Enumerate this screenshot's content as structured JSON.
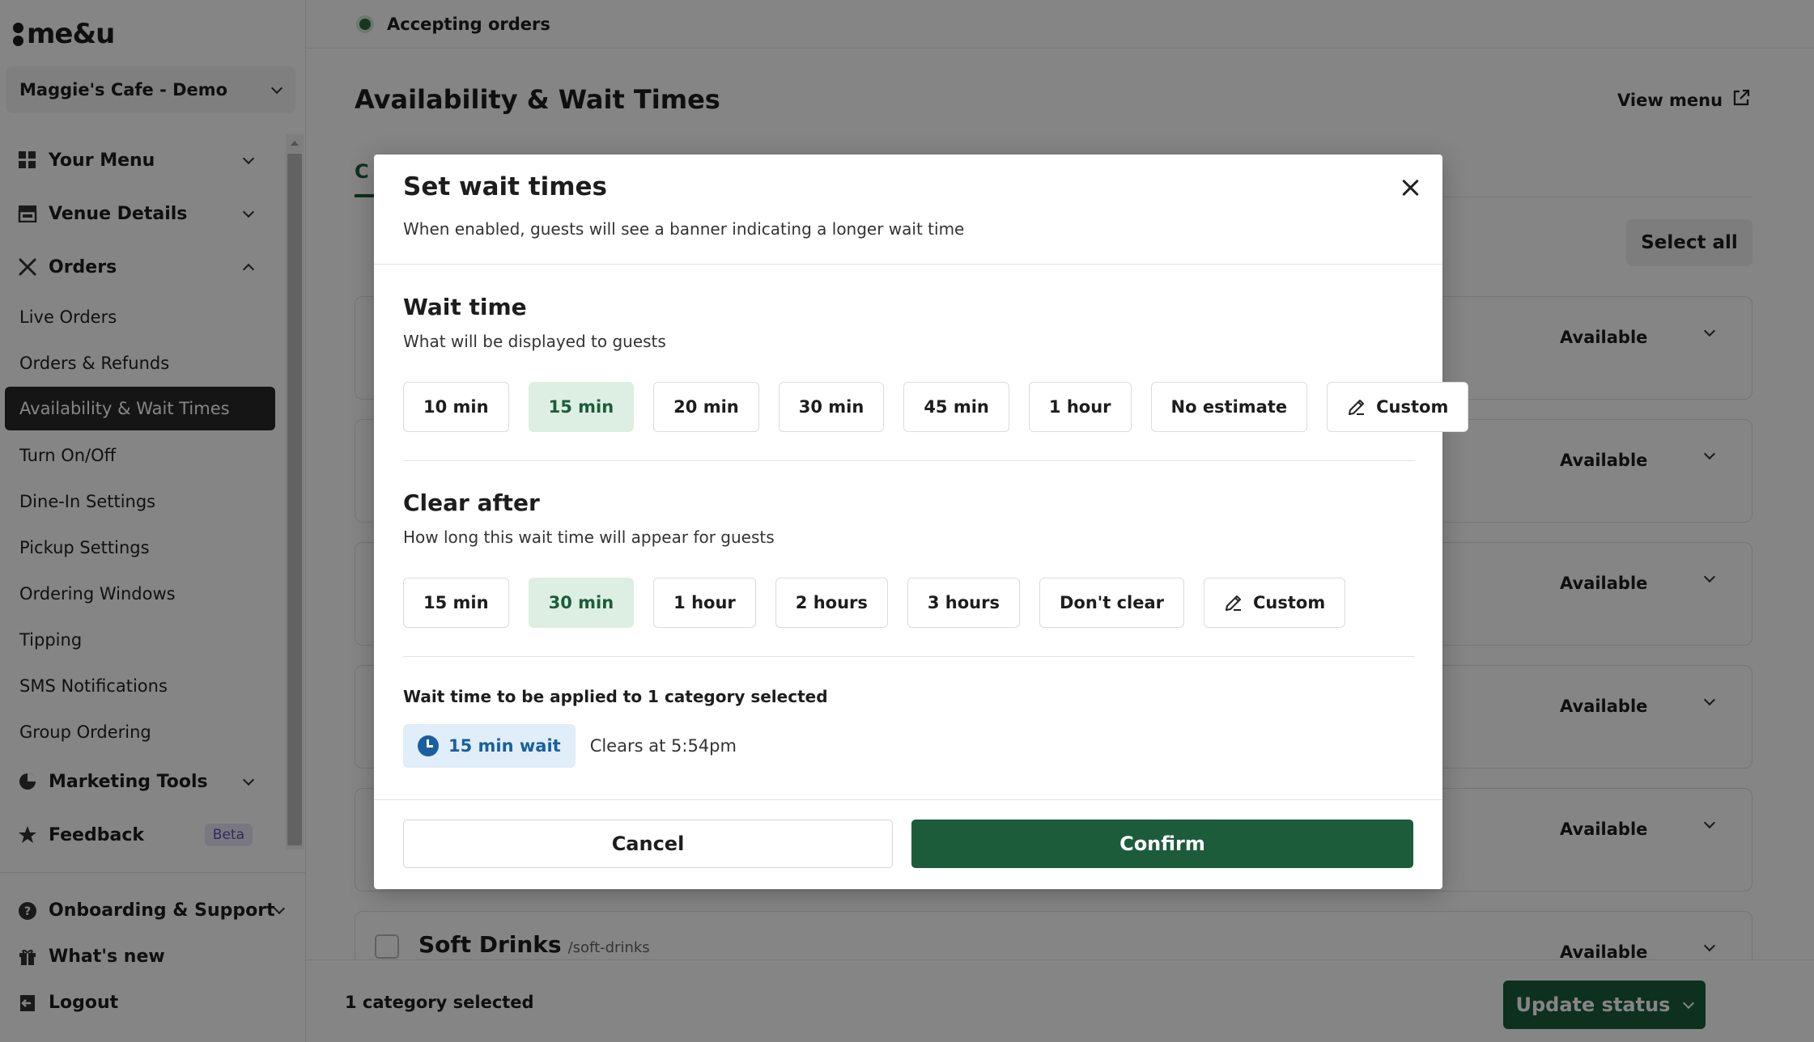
{
  "brand": {
    "logo_text": "me&u"
  },
  "sidebar": {
    "venue": "Maggie's Cafe - Demo",
    "sections": [
      {
        "label": "Your Menu",
        "icon": "grid-icon"
      },
      {
        "label": "Venue Details",
        "icon": "storefront-icon"
      },
      {
        "label": "Orders",
        "icon": "utensils-icon"
      }
    ],
    "order_items": [
      {
        "label": "Live Orders"
      },
      {
        "label": "Orders & Refunds"
      },
      {
        "label": "Availability & Wait Times"
      },
      {
        "label": "Turn On/Off"
      },
      {
        "label": "Dine-In Settings"
      },
      {
        "label": "Pickup Settings"
      },
      {
        "label": "Ordering Windows"
      },
      {
        "label": "Tipping"
      },
      {
        "label": "SMS Notifications"
      },
      {
        "label": "Group Ordering"
      }
    ],
    "marketing": "Marketing Tools",
    "feedback": "Feedback",
    "feedback_badge": "Beta",
    "bottom": [
      {
        "label": "Onboarding & Support",
        "icon": "help-circle-icon"
      },
      {
        "label": "What's new",
        "icon": "gift-icon"
      },
      {
        "label": "Logout",
        "icon": "logout-icon"
      }
    ]
  },
  "main": {
    "status": "Accepting orders",
    "page_title": "Availability & Wait Times",
    "view_menu": "View menu",
    "tab_visible": "C",
    "select_all": "Select all",
    "rows": [
      {
        "status": "Available"
      },
      {
        "status": "Available"
      },
      {
        "status": "Available"
      },
      {
        "status": "Available"
      },
      {
        "status": "Available"
      },
      {
        "name": "Soft Drinks",
        "slug": "/soft-drinks",
        "status": "Available"
      }
    ],
    "footer_count": "1 category selected",
    "update_status": "Update status"
  },
  "modal": {
    "title": "Set wait times",
    "subtitle": "When enabled, guests will see a banner indicating a longer wait time",
    "wait_time": {
      "title": "Wait time",
      "subtitle": "What will be displayed to guests",
      "options": [
        "10 min",
        "15 min",
        "20 min",
        "30 min",
        "45 min",
        "1 hour",
        "No estimate"
      ],
      "custom": "Custom",
      "selected": "15 min"
    },
    "clear_after": {
      "title": "Clear after",
      "subtitle": "How long this wait time will appear for guests",
      "options": [
        "15 min",
        "30 min",
        "1 hour",
        "2 hours",
        "3 hours",
        "Don't clear"
      ],
      "custom": "Custom",
      "selected": "30 min"
    },
    "summary": {
      "title": "Wait time to be applied to 1 category selected",
      "badge": "15 min wait",
      "clears": "Clears at 5:54pm"
    },
    "cancel": "Cancel",
    "confirm": "Confirm"
  },
  "colors": {
    "primary_green": "#1c5c3b",
    "selected_bg": "#dcefe2",
    "badge_blue": "#1a5f9e",
    "badge_bg": "#e0eefa",
    "overlay": "rgba(0,0,0,0.48)"
  }
}
